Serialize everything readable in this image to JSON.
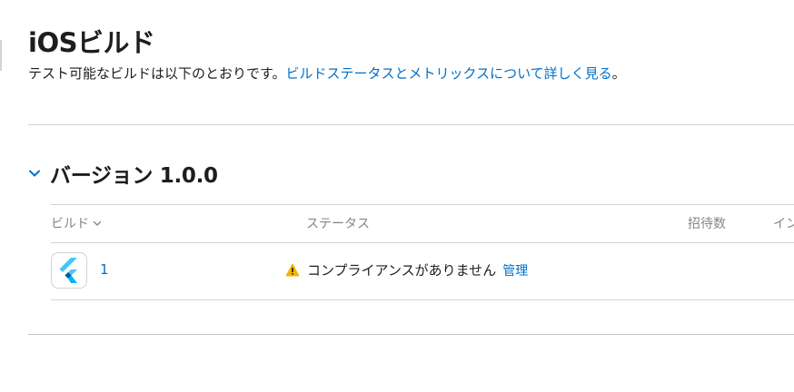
{
  "header": {
    "title": "iOSビルド",
    "subtitle_prefix": "テスト可能なビルドは以下のとおりです。",
    "subtitle_link": "ビルドステータスとメトリックスについて詳しく見る",
    "subtitle_suffix": "。"
  },
  "version": {
    "title": "バージョン 1.0.0",
    "expanded": true
  },
  "table": {
    "columns": {
      "build": "ビルド",
      "status": "ステータス",
      "invites": "招待数",
      "extra": "イン"
    },
    "rows": [
      {
        "icon": "flutter-app-icon",
        "build": "1",
        "status_icon": "warning-icon",
        "status": "コンプライアンスがありません",
        "action": "管理"
      }
    ]
  },
  "colors": {
    "link": "#0070c9",
    "warning": "#f5b400",
    "text": "#1d1d1f",
    "muted": "#86868b"
  }
}
